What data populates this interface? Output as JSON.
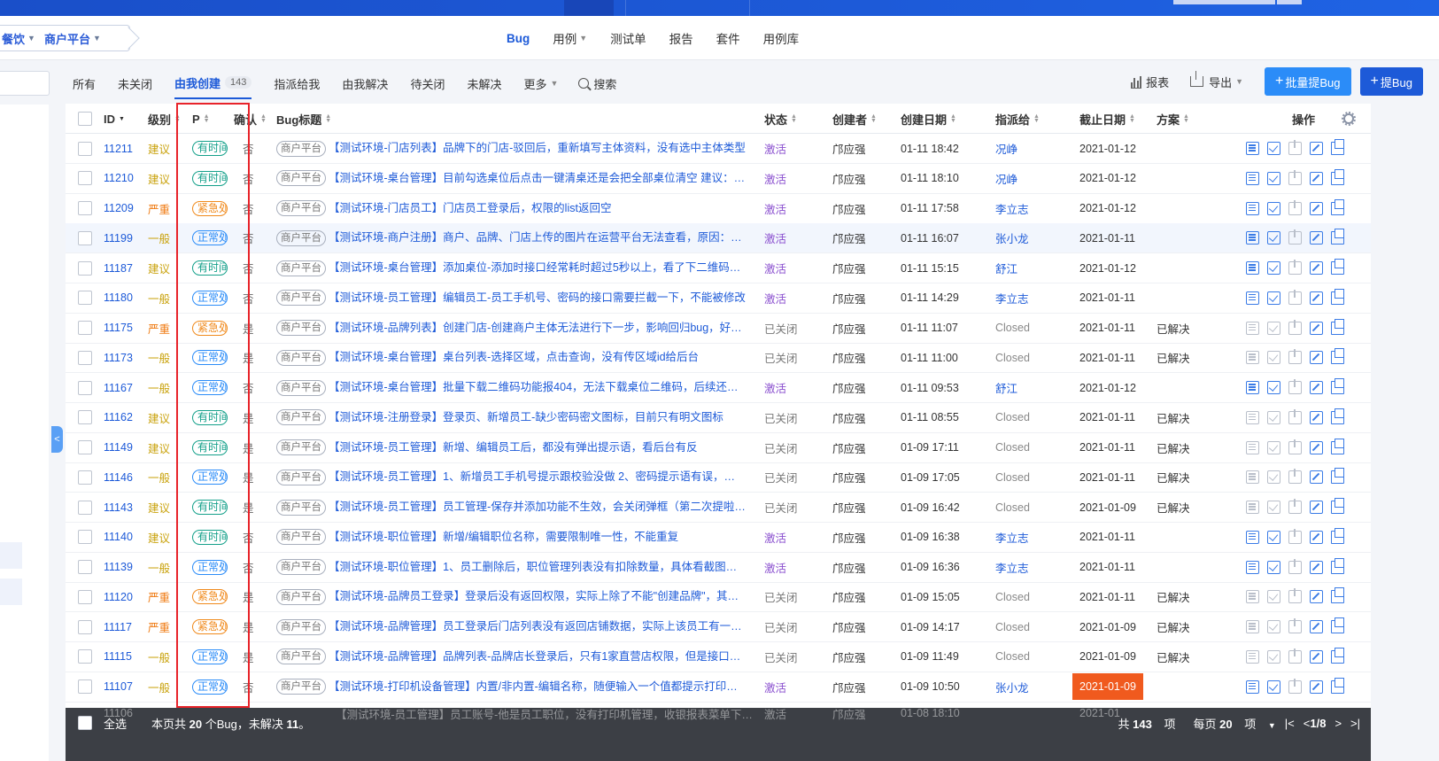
{
  "breadcrumb": {
    "items": [
      "餐饮",
      "商户平台"
    ]
  },
  "main_nav": [
    {
      "label": "Bug",
      "active": true,
      "dropdown": false
    },
    {
      "label": "用例",
      "active": false,
      "dropdown": true
    },
    {
      "label": "测试单",
      "active": false,
      "dropdown": false
    },
    {
      "label": "报告",
      "active": false,
      "dropdown": false
    },
    {
      "label": "套件",
      "active": false,
      "dropdown": false
    },
    {
      "label": "用例库",
      "active": false,
      "dropdown": false
    }
  ],
  "sub_nav": {
    "tabs": [
      {
        "label": "所有"
      },
      {
        "label": "未关闭"
      },
      {
        "label": "由我创建",
        "badge": "143",
        "active": true
      },
      {
        "label": "指派给我"
      },
      {
        "label": "由我解决"
      },
      {
        "label": "待关闭"
      },
      {
        "label": "未解决"
      },
      {
        "label": "更多",
        "dropdown": true
      }
    ],
    "search_label": "搜索"
  },
  "actions": {
    "report_label": "报表",
    "export_label": "导出",
    "batch_label": "批量提Bug",
    "submit_label": "提Bug"
  },
  "table": {
    "headers": {
      "id": "ID",
      "level": "级别",
      "priority": "P",
      "confirm": "确认",
      "title": "Bug标题",
      "status": "状态",
      "creator": "创建者",
      "created": "创建日期",
      "assignee": "指派给",
      "deadline": "截止日期",
      "solution": "方案",
      "ops": "操作"
    },
    "rows": [
      {
        "id": "11211",
        "level": "建议",
        "level_color": "#c9a20c",
        "p": "有时间",
        "p_color": "#14a08a",
        "confirm": "否",
        "module": "商户平台",
        "title": "【测试环境-门店列表】品牌下的门店-驳回后，重新填写主体资料，没有选中主体类型",
        "status": "激活",
        "creator": "邝应强",
        "created": "01-11 18:42",
        "assignee": "况峥",
        "deadline": "2021-01-12",
        "solution": "",
        "closed": false
      },
      {
        "id": "11210",
        "level": "建议",
        "level_color": "#c9a20c",
        "p": "有时间",
        "p_color": "#14a08a",
        "confirm": "否",
        "module": "商户平台",
        "title": "【测试环境-桌台管理】目前勾选桌位后点击一键清桌还是会把全部桌位清空 建议：…",
        "status": "激活",
        "creator": "邝应强",
        "created": "01-11 18:10",
        "assignee": "况峥",
        "deadline": "2021-01-12",
        "solution": "",
        "closed": false
      },
      {
        "id": "11209",
        "level": "严重",
        "level_color": "#ef7a12",
        "p": "紧急处理",
        "p_color": "#f08a1c",
        "confirm": "否",
        "module": "商户平台",
        "title": "【测试环境-门店员工】门店员工登录后，权限的list返回空",
        "status": "激活",
        "creator": "邝应强",
        "created": "01-11 17:58",
        "assignee": "李立志",
        "deadline": "2021-01-12",
        "solution": "",
        "closed": false
      },
      {
        "id": "11199",
        "level": "一般",
        "level_color": "#c9a20c",
        "p": "正常处理",
        "p_color": "#2b8cf8",
        "confirm": "否",
        "module": "商户平台",
        "title": "【测试环境-商户注册】商户、品牌、门店上传的图片在运营平台无法查看，原因：…",
        "status": "激活",
        "creator": "邝应强",
        "created": "01-11 16:07",
        "assignee": "张小龙",
        "deadline": "2021-01-11",
        "solution": "",
        "closed": false,
        "highlight": true
      },
      {
        "id": "11187",
        "level": "建议",
        "level_color": "#c9a20c",
        "p": "有时间",
        "p_color": "#14a08a",
        "confirm": "否",
        "module": "商户平台",
        "title": "【测试环境-桌台管理】添加桌位-添加时接口经常耗时超过5秒以上，看了下二维码…",
        "status": "激活",
        "creator": "邝应强",
        "created": "01-11 15:15",
        "assignee": "舒江",
        "deadline": "2021-01-12",
        "solution": "",
        "closed": false
      },
      {
        "id": "11180",
        "level": "一般",
        "level_color": "#c9a20c",
        "p": "正常处理",
        "p_color": "#2b8cf8",
        "confirm": "否",
        "module": "商户平台",
        "title": "【测试环境-员工管理】编辑员工-员工手机号、密码的接口需要拦截一下，不能被修改",
        "status": "激活",
        "creator": "邝应强",
        "created": "01-11 14:29",
        "assignee": "李立志",
        "deadline": "2021-01-11",
        "solution": "",
        "closed": false
      },
      {
        "id": "11175",
        "level": "严重",
        "level_color": "#ef7a12",
        "p": "紧急处理",
        "p_color": "#f08a1c",
        "confirm": "是",
        "module": "商户平台",
        "title": "【测试环境-品牌列表】创建门店-创建商户主体无法进行下一步，影响回归bug，好…",
        "status": "已关闭",
        "creator": "邝应强",
        "created": "01-11 11:07",
        "assignee": "Closed",
        "deadline": "2021-01-11",
        "solution": "已解决",
        "closed": true
      },
      {
        "id": "11173",
        "level": "一般",
        "level_color": "#c9a20c",
        "p": "正常处理",
        "p_color": "#2b8cf8",
        "confirm": "是",
        "module": "商户平台",
        "title": "【测试环境-桌台管理】桌台列表-选择区域，点击查询，没有传区域id给后台",
        "status": "已关闭",
        "creator": "邝应强",
        "created": "01-11 11:00",
        "assignee": "Closed",
        "deadline": "2021-01-11",
        "solution": "已解决",
        "closed": true
      },
      {
        "id": "11167",
        "level": "一般",
        "level_color": "#c9a20c",
        "p": "正常处理",
        "p_color": "#2b8cf8",
        "confirm": "否",
        "module": "商户平台",
        "title": "【测试环境-桌台管理】批量下载二维码功能报404，无法下载桌位二维码，后续还…",
        "status": "激活",
        "creator": "邝应强",
        "created": "01-11 09:53",
        "assignee": "舒江",
        "deadline": "2021-01-12",
        "solution": "",
        "closed": false
      },
      {
        "id": "11162",
        "level": "建议",
        "level_color": "#c9a20c",
        "p": "有时间",
        "p_color": "#14a08a",
        "confirm": "是",
        "module": "商户平台",
        "title": "【测试环境-注册登录】登录页、新增员工-缺少密码密文图标，目前只有明文图标",
        "status": "已关闭",
        "creator": "邝应强",
        "created": "01-11 08:55",
        "assignee": "Closed",
        "deadline": "2021-01-11",
        "solution": "已解决",
        "closed": true
      },
      {
        "id": "11149",
        "level": "建议",
        "level_color": "#c9a20c",
        "p": "有时间",
        "p_color": "#14a08a",
        "confirm": "是",
        "module": "商户平台",
        "title": "【测试环境-员工管理】新增、编辑员工后，都没有弹出提示语，看后台有反",
        "status": "已关闭",
        "creator": "邝应强",
        "created": "01-09 17:11",
        "assignee": "Closed",
        "deadline": "2021-01-11",
        "solution": "已解决",
        "closed": true
      },
      {
        "id": "11146",
        "level": "一般",
        "level_color": "#c9a20c",
        "p": "正常处理",
        "p_color": "#2b8cf8",
        "confirm": "是",
        "module": "商户平台",
        "title": "【测试环境-员工管理】1、新增员工手机号提示跟校验没做 2、密码提示语有误，…",
        "status": "已关闭",
        "creator": "邝应强",
        "created": "01-09 17:05",
        "assignee": "Closed",
        "deadline": "2021-01-11",
        "solution": "已解决",
        "closed": true
      },
      {
        "id": "11143",
        "level": "建议",
        "level_color": "#c9a20c",
        "p": "有时间",
        "p_color": "#14a08a",
        "confirm": "是",
        "module": "商户平台",
        "title": "【测试环境-员工管理】员工管理-保存并添加功能不生效，会关闭弹框（第二次提啦…",
        "status": "已关闭",
        "creator": "邝应强",
        "created": "01-09 16:42",
        "assignee": "Closed",
        "deadline": "2021-01-09",
        "solution": "已解决",
        "closed": true
      },
      {
        "id": "11140",
        "level": "建议",
        "level_color": "#c9a20c",
        "p": "有时间",
        "p_color": "#14a08a",
        "confirm": "否",
        "module": "商户平台",
        "title": "【测试环境-职位管理】新增/编辑职位名称，需要限制唯一性，不能重复",
        "status": "激活",
        "creator": "邝应强",
        "created": "01-09 16:38",
        "assignee": "李立志",
        "deadline": "2021-01-11",
        "solution": "",
        "closed": false
      },
      {
        "id": "11139",
        "level": "一般",
        "level_color": "#c9a20c",
        "p": "正常处理",
        "p_color": "#2b8cf8",
        "confirm": "否",
        "module": "商户平台",
        "title": "【测试环境-职位管理】1、员工删除后，职位管理列表没有扣除数量，具体看截图…",
        "status": "激活",
        "creator": "邝应强",
        "created": "01-09 16:36",
        "assignee": "李立志",
        "deadline": "2021-01-11",
        "solution": "",
        "closed": false
      },
      {
        "id": "11120",
        "level": "严重",
        "level_color": "#ef7a12",
        "p": "紧急处理",
        "p_color": "#f08a1c",
        "confirm": "是",
        "module": "商户平台",
        "title": "【测试环境-品牌员工登录】登录后没有返回权限，实际上除了不能\"创建品牌\"，其…",
        "status": "已关闭",
        "creator": "邝应强",
        "created": "01-09 15:05",
        "assignee": "Closed",
        "deadline": "2021-01-11",
        "solution": "已解决",
        "closed": true
      },
      {
        "id": "11117",
        "level": "严重",
        "level_color": "#ef7a12",
        "p": "紧急处理",
        "p_color": "#f08a1c",
        "confirm": "是",
        "module": "商户平台",
        "title": "【测试环境-品牌管理】员工登录后门店列表没有返回店铺数据，实际上该员工有一…",
        "status": "已关闭",
        "creator": "邝应强",
        "created": "01-09 14:17",
        "assignee": "Closed",
        "deadline": "2021-01-09",
        "solution": "已解决",
        "closed": true
      },
      {
        "id": "11115",
        "level": "一般",
        "level_color": "#c9a20c",
        "p": "正常处理",
        "p_color": "#2b8cf8",
        "confirm": "是",
        "module": "商户平台",
        "title": "【测试环境-品牌管理】品牌列表-品牌店长登录后，只有1家直营店权限，但是接口…",
        "status": "已关闭",
        "creator": "邝应强",
        "created": "01-09 11:49",
        "assignee": "Closed",
        "deadline": "2021-01-09",
        "solution": "已解决",
        "closed": true
      },
      {
        "id": "11107",
        "level": "一般",
        "level_color": "#c9a20c",
        "p": "正常处理",
        "p_color": "#2b8cf8",
        "confirm": "否",
        "module": "商户平台",
        "title": "【测试环境-打印机设备管理】内置/非内置-编辑名称，随便输入一个值都提示打印…",
        "status": "激活",
        "creator": "邝应强",
        "created": "01-09 10:50",
        "assignee": "张小龙",
        "deadline": "2021-01-09",
        "solution": "",
        "closed": false,
        "deadline_overdue": true
      }
    ],
    "ghost_row": {
      "id": "11106",
      "title": "【测试环境-员工管理】员工账号-他是员工职位，没有打印机管理，收银报表菜单下…",
      "status": "激活",
      "creator": "邝应强",
      "created": "01-08 18:10",
      "deadline": "2021-01"
    }
  },
  "footer": {
    "select_all": "全选",
    "summary_prefix": "本页共",
    "summary_count": "20",
    "summary_mid": "个Bug，未解决",
    "summary_unresolved": "11",
    "summary_suffix": "。",
    "total_prefix": "共",
    "total": "143",
    "total_suffix": "项",
    "per_page_prefix": "每页",
    "per_page": "20",
    "per_page_suffix": "项",
    "page": "1/8"
  }
}
